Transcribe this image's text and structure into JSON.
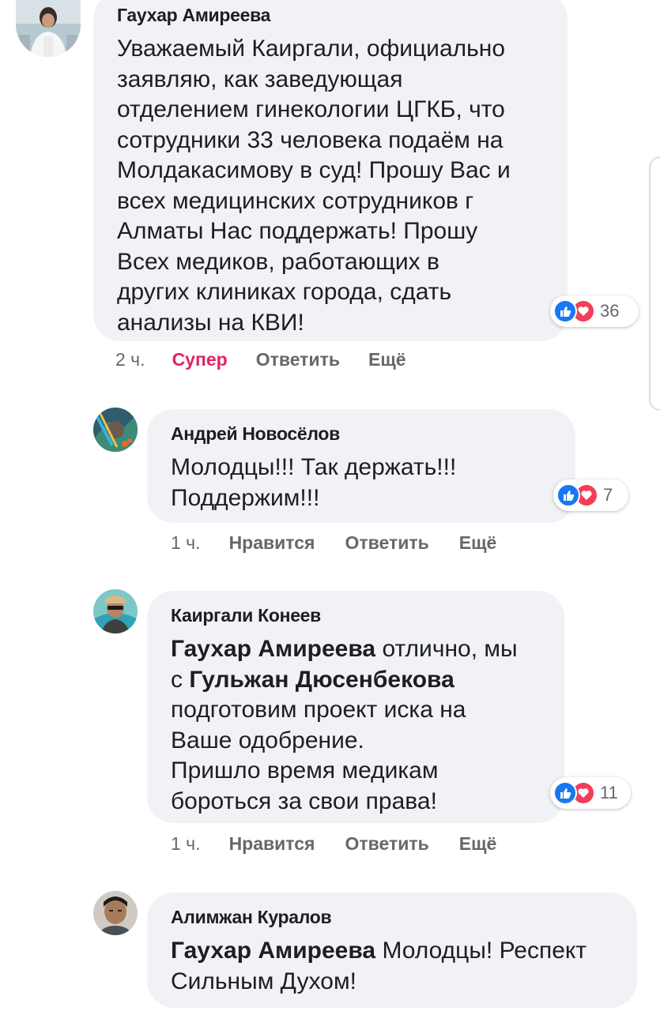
{
  "comments": [
    {
      "author": "Гаухар Амиреева",
      "lines": [
        "Уважаемый Каиргали, официально",
        "заявляю, как заведующая",
        "отделением гинекологии ЦГКБ, что",
        "сотрудники 33 человека подаём на",
        "Молдакасимову в суд! Прошу Вас и",
        "всех медицинских сотрудников г",
        "Алматы Нас поддержать! Прошу",
        "Всех медиков, работающих в",
        "других клиниках города, сдать",
        "анализы на КВИ!"
      ],
      "reactions": {
        "count": "36",
        "icons": [
          "like-icon",
          "love-icon"
        ]
      },
      "time": "2 ч.",
      "like_label": "Супер",
      "reply_label": "Ответить",
      "more_label": "Ещё"
    },
    {
      "author": "Андрей Новосёлов",
      "lines": [
        "Молодцы!!! Так держать!!!",
        "Поддержим!!!"
      ],
      "reactions": {
        "count": "7",
        "icons": [
          "like-icon",
          "love-icon"
        ]
      },
      "time": "1 ч.",
      "like_label": "Нравится",
      "reply_label": "Ответить",
      "more_label": "Ещё"
    },
    {
      "author": "Каиргали Конеев",
      "mention1": "Гаухар Амиреева",
      "line1_rest": " отлично, мы",
      "line2_pre": "с ",
      "mention2": "Гульжан Дюсенбекова",
      "lines": [
        "подготовим проект иска на",
        "Ваше одобрение.",
        "Пришло время медикам",
        "бороться за свои права!"
      ],
      "reactions": {
        "count": "11",
        "icons": [
          "like-icon",
          "love-icon"
        ]
      },
      "time": "1 ч.",
      "like_label": "Нравится",
      "reply_label": "Ответить",
      "more_label": "Ещё"
    },
    {
      "author": "Алимжан Куралов",
      "mention1": "Гаухар Амиреева",
      "line1_rest": " Молодцы! Респект",
      "lines": [
        "Сильным Духом!"
      ]
    }
  ],
  "colors": {
    "bubble": "#f0f2f5",
    "like_blue": "#1877f2",
    "love_red": "#f33e58",
    "active_reaction": "#e0245e",
    "secondary_text": "#65676b"
  }
}
